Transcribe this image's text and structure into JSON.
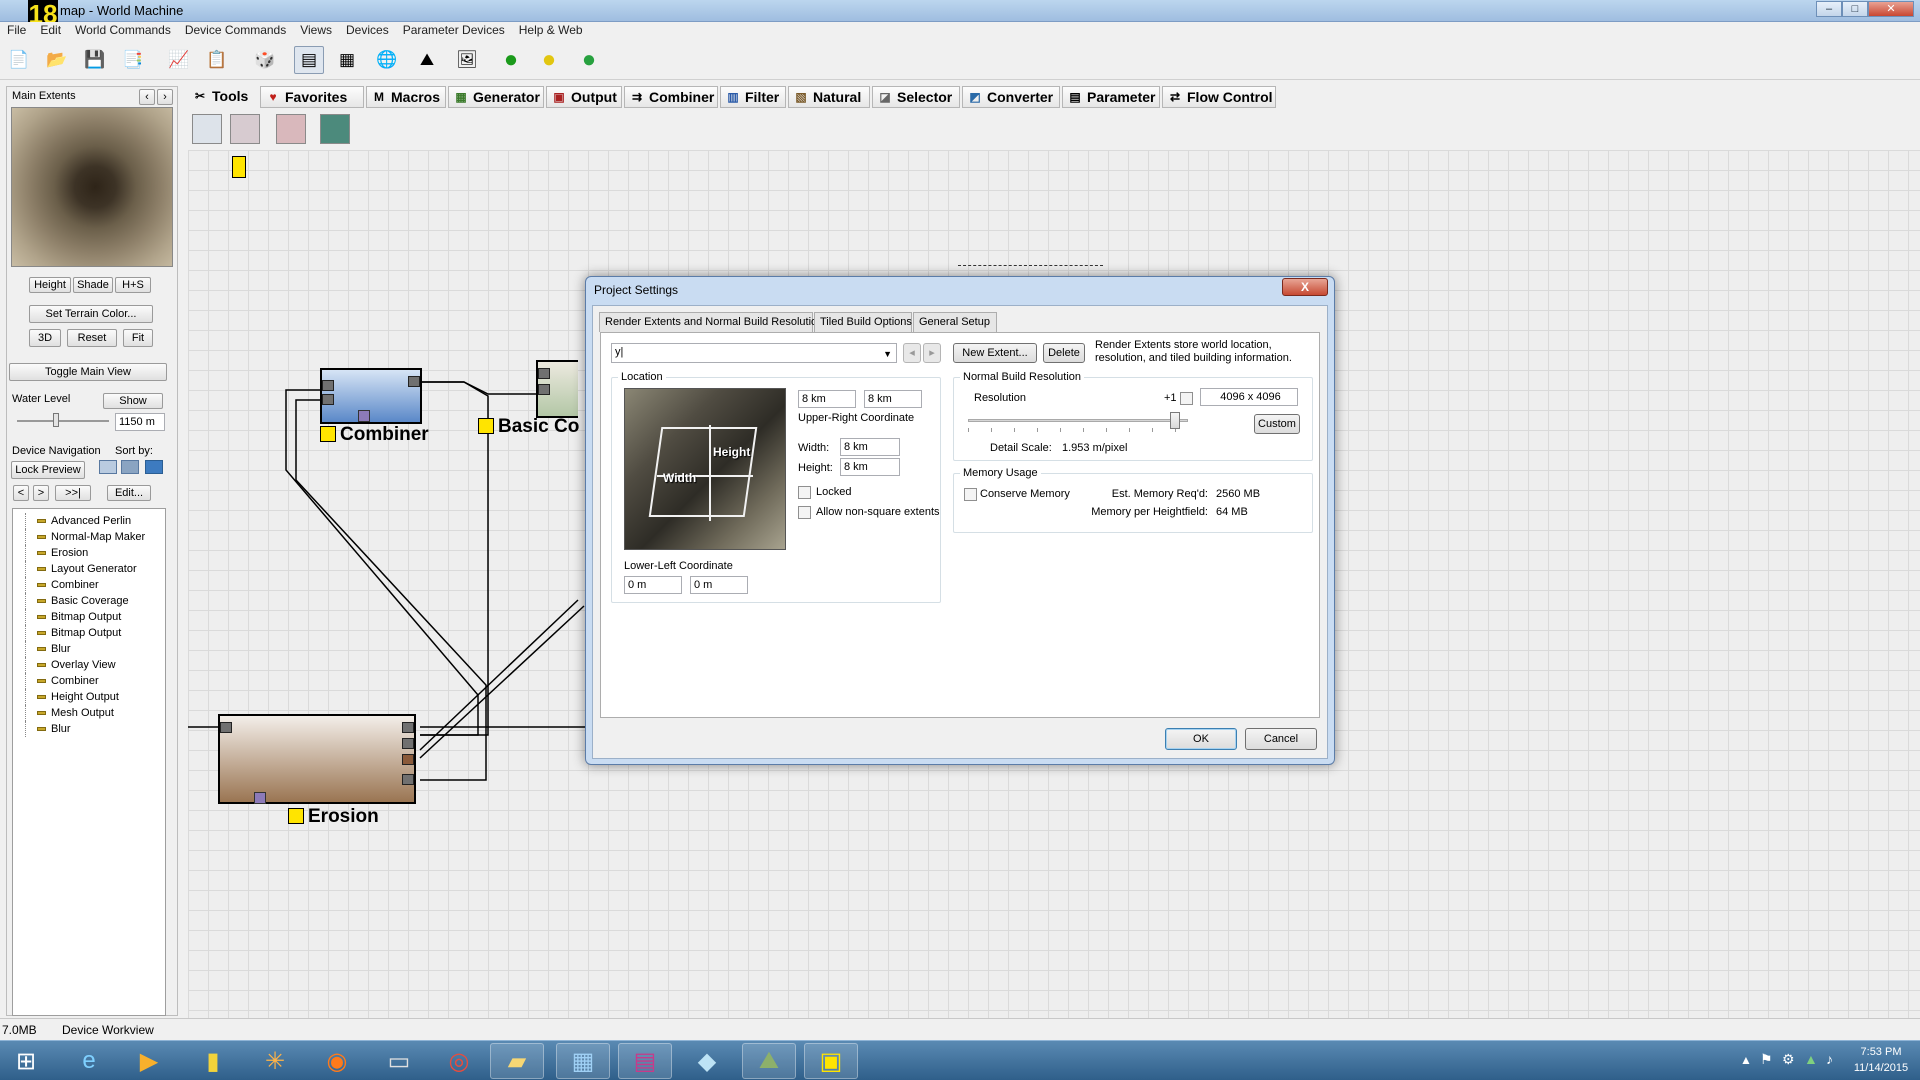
{
  "window": {
    "title": "map - World Machine",
    "logo_text": "18"
  },
  "menu": [
    "File",
    "Edit",
    "World Commands",
    "Device Commands",
    "Views",
    "Devices",
    "Parameter Devices",
    "Help & Web"
  ],
  "left_panel": {
    "header": "Main Extents",
    "view_buttons": [
      "Height",
      "Shade",
      "H+S"
    ],
    "set_terrain_color": "Set Terrain Color...",
    "btn_3d": "3D",
    "btn_reset": "Reset",
    "btn_fit": "Fit",
    "toggle_main_view": "Toggle Main View",
    "water_level_label": "Water Level",
    "water_show": "Show",
    "water_value": "1150 m",
    "device_nav_label": "Device Navigation",
    "sort_by_label": "Sort by:",
    "lock_preview": "Lock Preview",
    "nav_prev": "<",
    "nav_next": ">",
    "nav_last": ">>|",
    "edit": "Edit...",
    "devices": [
      "Advanced Perlin",
      "Normal-Map Maker",
      "Erosion",
      "Layout Generator",
      "Combiner",
      "Basic Coverage",
      "Bitmap Output",
      "Bitmap Output",
      "Blur",
      "Overlay View",
      "Combiner",
      "Height Output",
      "Mesh Output",
      "Blur"
    ]
  },
  "tabs": [
    "Tools",
    "Favorites",
    "Macros",
    "Generator",
    "Output",
    "Combiner",
    "Filter",
    "Natural",
    "Selector",
    "Converter",
    "Parameter",
    "Flow Control"
  ],
  "nodes": {
    "combiner": "Combiner",
    "basic": "Basic Co",
    "erosion": "Erosion"
  },
  "statusbar": {
    "memory": "7.0MB",
    "view": "Device Workview"
  },
  "clock": {
    "time": "7:53 PM",
    "date": "11/14/2015"
  },
  "dialog": {
    "title": "Project Settings",
    "close": "X",
    "tabs": [
      "Render Extents and Normal Build Resolution",
      "Tiled Build Options",
      "General Setup"
    ],
    "extent_value": "y|",
    "new_extent": "New Extent...",
    "delete": "Delete",
    "info": "Render Extents store world location, resolution, and tiled building information.",
    "location_title": "Location",
    "ur_x": "8 km",
    "ur_y": "8 km",
    "ur_label": "Upper-Right Coordinate",
    "width_label": "Width:",
    "width_value": "8 km",
    "height_label": "Height:",
    "height_value": "8 km",
    "locked": "Locked",
    "non_square": "Allow non-square extents",
    "img_height": "Height",
    "img_width": "Width",
    "ll_label": "Lower-Left Coordinate",
    "ll_x": "0 m",
    "ll_y": "0 m",
    "nbr_title": "Normal Build Resolution",
    "resolution_label": "Resolution",
    "plus_one": "+1",
    "resolution_value": "4096 x 4096",
    "custom": "Custom",
    "detail_scale_label": "Detail Scale:",
    "detail_scale_value": "1.953 m/pixel",
    "memory_title": "Memory Usage",
    "conserve": "Conserve Memory",
    "est_label": "Est. Memory Req'd:",
    "est_value": "2560 MB",
    "mph_label": "Memory per Heightfield:",
    "mph_value": "64 MB",
    "ok": "OK",
    "cancel": "Cancel"
  }
}
